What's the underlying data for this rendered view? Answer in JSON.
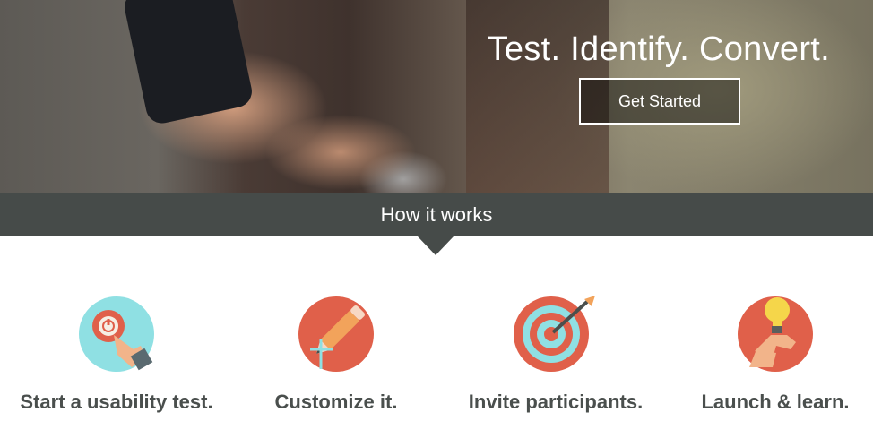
{
  "hero": {
    "title": "Test. Identify. Convert.",
    "cta_label": "Get Started"
  },
  "section": {
    "title": "How it works"
  },
  "steps": [
    {
      "label": "Start a usability test.",
      "icon": "power-button-hand-icon"
    },
    {
      "label": "Customize it.",
      "icon": "pencil-icon"
    },
    {
      "label": "Invite participants.",
      "icon": "target-arrow-icon"
    },
    {
      "label": "Launch & learn.",
      "icon": "lightbulb-hand-icon"
    }
  ],
  "colors": {
    "band": "#464b49",
    "step_text": "#4a4f4d",
    "icon_teal": "#8fe0e3",
    "icon_red": "#e0604a",
    "icon_orange": "#f2a35b"
  }
}
